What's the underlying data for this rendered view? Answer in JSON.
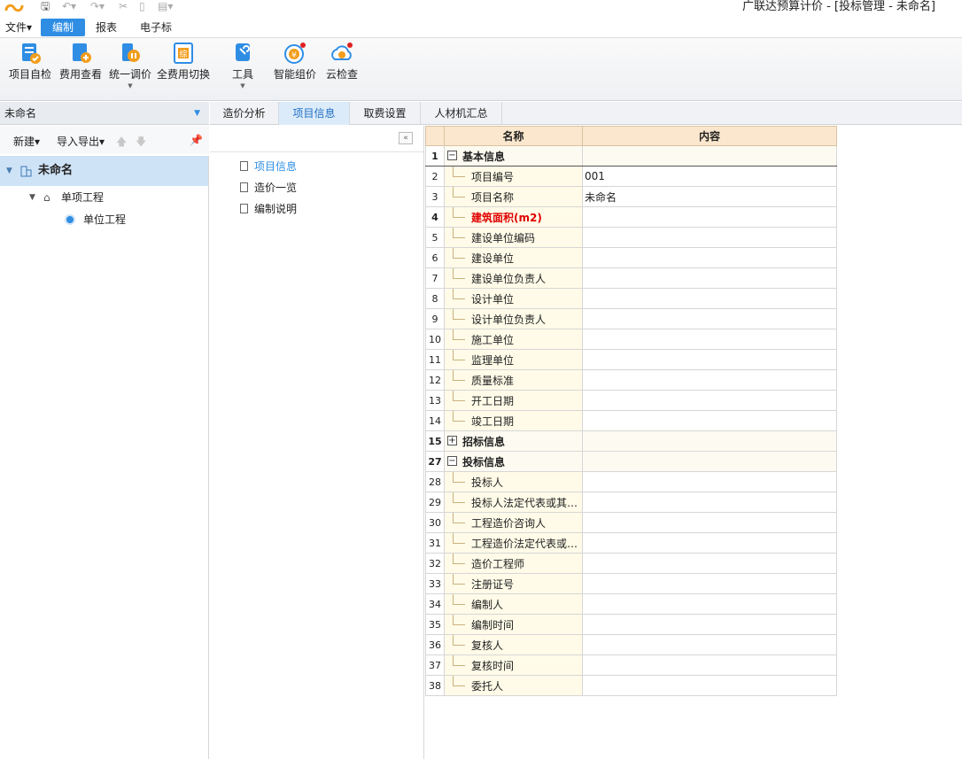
{
  "window": {
    "title": "广联达预算计价 - [投标管理 - 未命名]"
  },
  "menu": {
    "file": "文件▾",
    "edit": "编制",
    "report": "报表",
    "ebid": "电子标"
  },
  "ribbon": {
    "self_check": "项目自检",
    "fee_view": "费用查看",
    "adjust_price": "统一调价",
    "switch_fee": "全费用切换",
    "tools": "工具",
    "smart_price": "智能组价",
    "cloud_check": "云检查"
  },
  "left": {
    "project_name": "未命名",
    "new": "新建▾",
    "import_export": "导入导出▾",
    "tree": [
      {
        "label": "未命名"
      },
      {
        "label": "单项工程"
      },
      {
        "label": "单位工程"
      }
    ]
  },
  "tabs": [
    "造价分析",
    "项目信息",
    "取费设置",
    "人材机汇总"
  ],
  "nav": [
    "项目信息",
    "造价一览",
    "编制说明"
  ],
  "grid": {
    "headers": [
      "名称",
      "内容"
    ],
    "rows": [
      {
        "no": "1",
        "name": "基本信息",
        "content": "",
        "kind": "group",
        "exp": "−"
      },
      {
        "no": "2",
        "name": "项目编号",
        "content": "001"
      },
      {
        "no": "3",
        "name": "项目名称",
        "content": "未命名"
      },
      {
        "no": "4",
        "name": "建筑面积(m2)",
        "content": "",
        "kind": "required"
      },
      {
        "no": "5",
        "name": "建设单位编码",
        "content": ""
      },
      {
        "no": "6",
        "name": "建设单位",
        "content": ""
      },
      {
        "no": "7",
        "name": "建设单位负责人",
        "content": ""
      },
      {
        "no": "8",
        "name": "设计单位",
        "content": ""
      },
      {
        "no": "9",
        "name": "设计单位负责人",
        "content": ""
      },
      {
        "no": "10",
        "name": "施工单位",
        "content": ""
      },
      {
        "no": "11",
        "name": "监理单位",
        "content": ""
      },
      {
        "no": "12",
        "name": "质量标准",
        "content": ""
      },
      {
        "no": "13",
        "name": "开工日期",
        "content": ""
      },
      {
        "no": "14",
        "name": "竣工日期",
        "content": ""
      },
      {
        "no": "15",
        "name": "招标信息",
        "content": "",
        "kind": "group",
        "exp": "+"
      },
      {
        "no": "27",
        "name": "投标信息",
        "content": "",
        "kind": "group",
        "exp": "−"
      },
      {
        "no": "28",
        "name": "投标人",
        "content": ""
      },
      {
        "no": "29",
        "name": "投标人法定代表或其…",
        "content": ""
      },
      {
        "no": "30",
        "name": "工程造价咨询人",
        "content": ""
      },
      {
        "no": "31",
        "name": "工程造价法定代表或…",
        "content": ""
      },
      {
        "no": "32",
        "name": "造价工程师",
        "content": ""
      },
      {
        "no": "33",
        "name": "注册证号",
        "content": ""
      },
      {
        "no": "34",
        "name": "编制人",
        "content": ""
      },
      {
        "no": "35",
        "name": "编制时间",
        "content": ""
      },
      {
        "no": "36",
        "name": "复核人",
        "content": ""
      },
      {
        "no": "37",
        "name": "复核时间",
        "content": ""
      },
      {
        "no": "38",
        "name": "委托人",
        "content": ""
      }
    ]
  }
}
